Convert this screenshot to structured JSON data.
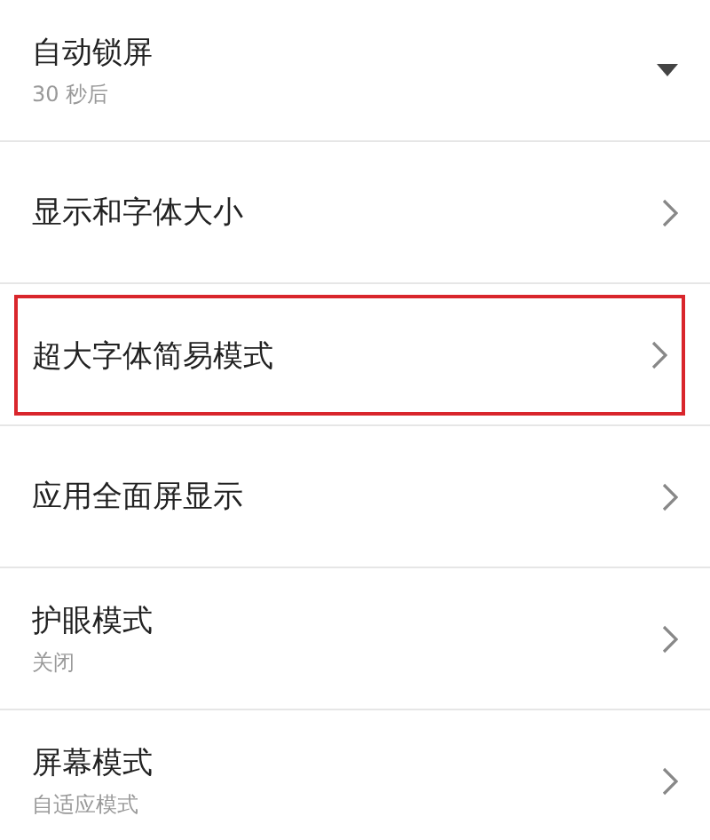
{
  "settings": [
    {
      "title": "自动锁屏",
      "subtitle": "30 秒后",
      "kind": "dropdown",
      "highlighted": false
    },
    {
      "title": "显示和字体大小",
      "kind": "chevron",
      "highlighted": false
    },
    {
      "title": "超大字体简易模式",
      "kind": "chevron",
      "highlighted": true
    },
    {
      "title": "应用全面屏显示",
      "kind": "chevron",
      "highlighted": false
    },
    {
      "title": "护眼模式",
      "subtitle": "关闭",
      "kind": "chevron",
      "highlighted": false
    },
    {
      "title": "屏幕模式",
      "subtitle": "自适应模式",
      "kind": "chevron",
      "highlighted": false
    }
  ]
}
